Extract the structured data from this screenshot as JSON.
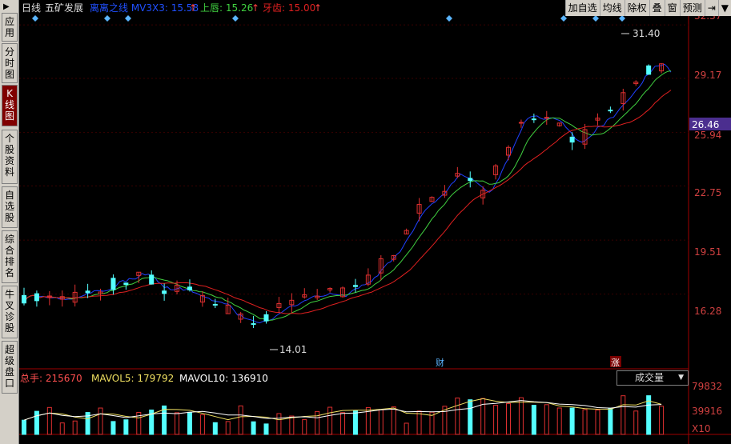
{
  "sidebar": {
    "top_icon": "▶",
    "items": [
      "应用",
      "分时图",
      "K线图",
      "个股资料",
      "自选股",
      "综合排名",
      "牛叉诊股",
      "超级盘口"
    ]
  },
  "header": {
    "period": "日线",
    "stock_name": "五矿发展",
    "indicator_1": "离离之线 MV3X3: 15.58",
    "upper_label": "上唇: 15.26",
    "tooth_label": "牙齿: 15.00",
    "up_arrow": "↑"
  },
  "toolbar": {
    "items": [
      "加自选",
      "均线",
      "除权",
      "叠",
      "窗",
      "预测"
    ],
    "exit_icon": "⇥",
    "menu_icon": "▼"
  },
  "chart_data": {
    "type": "candlestick",
    "price_axis_ticks": [
      "32.37",
      "29.17",
      "25.94",
      "22.75",
      "19.51",
      "16.28"
    ],
    "current_price": "26.46",
    "ylim": [
      13.3,
      32.9
    ],
    "max_label": "31.40",
    "min_label": "14.01",
    "event_markers": [
      "财",
      "涨"
    ],
    "volume": {
      "title": "成交量",
      "total_label": "总手: 215670",
      "ma5_label": "MAVOL5: 179792",
      "ma10_label": "MAVOL10: 136910",
      "axis_ticks": [
        "79832",
        "39916"
      ],
      "unit_label": "X10",
      "ylim": [
        0,
        100000
      ]
    },
    "colors": {
      "up": "#e03030",
      "down": "#54ffff",
      "ma1": "#2040ff",
      "ma2": "#40d040",
      "ma3": "#e02020",
      "axis": "#a00000",
      "current": "#4b2e8f"
    }
  }
}
